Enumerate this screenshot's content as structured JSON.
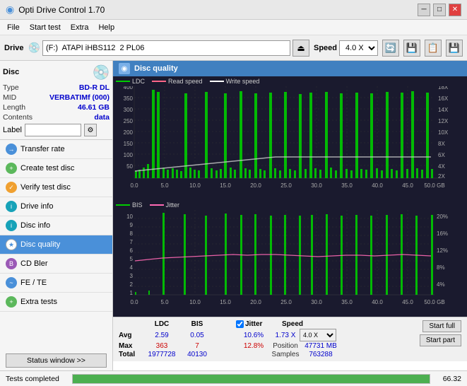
{
  "titlebar": {
    "title": "Opti Drive Control 1.70",
    "minimize": "─",
    "maximize": "□",
    "close": "✕"
  },
  "menubar": {
    "items": [
      "File",
      "Start test",
      "Extra",
      "Help"
    ]
  },
  "toolbar": {
    "drive_label": "Drive",
    "drive_value": "(F:)  ATAPI iHBS112  2 PL06",
    "speed_label": "Speed",
    "speed_value": "4.0 X"
  },
  "disc": {
    "title": "Disc",
    "type_label": "Type",
    "type_value": "BD-R DL",
    "mid_label": "MID",
    "mid_value": "VERBATIMf (000)",
    "length_label": "Length",
    "length_value": "46.61 GB",
    "contents_label": "Contents",
    "contents_value": "data",
    "label_label": "Label"
  },
  "nav": {
    "items": [
      {
        "id": "transfer-rate",
        "label": "Transfer rate",
        "icon": "→"
      },
      {
        "id": "create-test-disc",
        "label": "Create test disc",
        "icon": "+"
      },
      {
        "id": "verify-test-disc",
        "label": "Verify test disc",
        "icon": "✓"
      },
      {
        "id": "drive-info",
        "label": "Drive info",
        "icon": "i"
      },
      {
        "id": "disc-info",
        "label": "Disc info",
        "icon": "i"
      },
      {
        "id": "disc-quality",
        "label": "Disc quality",
        "icon": "★",
        "active": true
      },
      {
        "id": "cd-bler",
        "label": "CD Bler",
        "icon": "B"
      },
      {
        "id": "fe-te",
        "label": "FE / TE",
        "icon": "~"
      },
      {
        "id": "extra-tests",
        "label": "Extra tests",
        "icon": "+"
      }
    ]
  },
  "status_window_btn": "Status window >>",
  "status_bar": {
    "text": "Tests completed",
    "progress": 100,
    "value": "66.32"
  },
  "disc_quality": {
    "title": "Disc quality",
    "top_chart": {
      "legend": [
        {
          "label": "LDC",
          "color": "#00cc00"
        },
        {
          "label": "Read speed",
          "color": "#ff6688"
        },
        {
          "label": "Write speed",
          "color": "#ffffff"
        }
      ],
      "y_axis": [
        "400",
        "350",
        "300",
        "250",
        "200",
        "150",
        "100",
        "50"
      ],
      "y_axis_right": [
        "18X",
        "16X",
        "14X",
        "12X",
        "10X",
        "8X",
        "6X",
        "4X",
        "2X"
      ],
      "x_axis": [
        "0.0",
        "5.0",
        "10.0",
        "15.0",
        "20.0",
        "25.0",
        "30.0",
        "35.0",
        "40.0",
        "45.0",
        "50.0 GB"
      ]
    },
    "bottom_chart": {
      "legend": [
        {
          "label": "BIS",
          "color": "#00cc00"
        },
        {
          "label": "Jitter",
          "color": "#ff69b4"
        }
      ],
      "y_axis": [
        "10",
        "9",
        "8",
        "7",
        "6",
        "5",
        "4",
        "3",
        "2",
        "1"
      ],
      "y_axis_right": [
        "20%",
        "16%",
        "12%",
        "8%",
        "4%"
      ],
      "x_axis": [
        "0.0",
        "5.0",
        "10.0",
        "15.0",
        "20.0",
        "25.0",
        "30.0",
        "35.0",
        "40.0",
        "45.0",
        "50.0 GB"
      ]
    },
    "stats": {
      "col_headers": [
        "LDC",
        "BIS",
        "",
        "Jitter",
        "Speed"
      ],
      "rows": [
        {
          "label": "Avg",
          "ldc": "2.59",
          "bis": "0.05",
          "jitter": "10.6%",
          "speed": "1.73 X"
        },
        {
          "label": "Max",
          "ldc": "363",
          "bis": "7",
          "jitter": "12.8%",
          "position": "47731 MB"
        },
        {
          "label": "Total",
          "ldc": "1977728",
          "bis": "40130",
          "jitter": "",
          "samples": "763288"
        }
      ],
      "jitter_checked": true,
      "speed_combo": "4.0 X",
      "position_label": "Position",
      "position_value": "47731 MB",
      "samples_label": "Samples",
      "samples_value": "763288",
      "start_full": "Start full",
      "start_part": "Start part"
    }
  }
}
